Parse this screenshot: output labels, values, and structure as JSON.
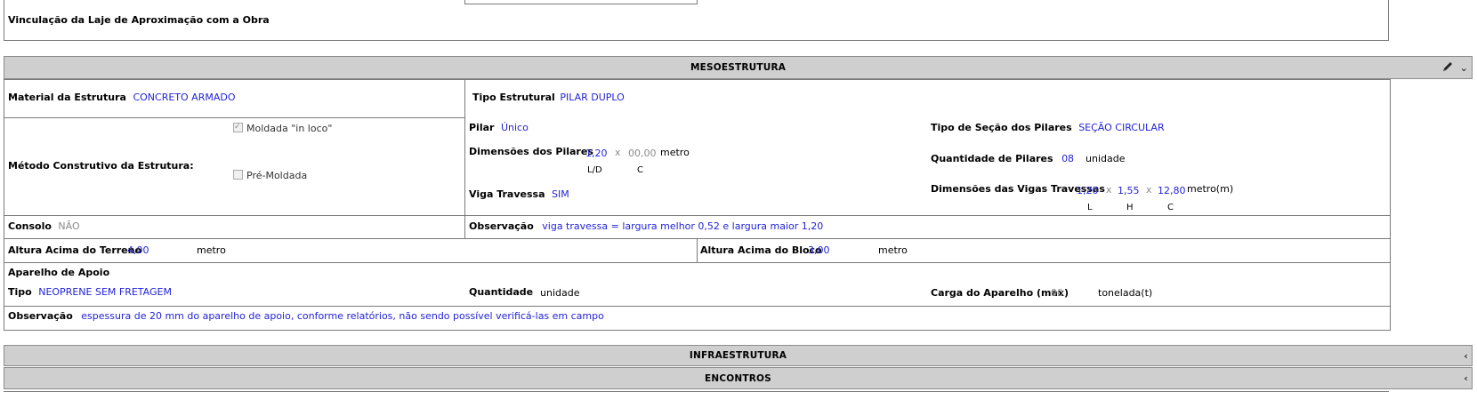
{
  "superestrutura": {
    "vinculacao_label": "Vinculação da Laje de Aproximação com a Obra"
  },
  "meso": {
    "title": "MESOESTRUTURA",
    "material_label": "Material da Estrutura",
    "material_value": "CONCRETO ARMADO",
    "tipo_estrutural_label": "Tipo Estrutural",
    "tipo_estrutural_value": "PILAR DUPLO",
    "metodo_label": "Método Construtivo da Estrutura:",
    "opt_moldada": "Moldada \"in loco\"",
    "opt_pre": "Pré-Moldada",
    "pilar_label": "Pilar",
    "pilar_value": "Único",
    "tipo_secao_label": "Tipo de Seção dos Pilares",
    "tipo_secao_value": "SEÇÃO CIRCULAR",
    "dim_pilares_label": "Dimensões dos Pilares",
    "dim_pilar_ld": "1,20",
    "times": "x",
    "dim_pilar_c": "00,00",
    "unit_metro": "metro",
    "sub_ld": "L/D",
    "sub_c": "C",
    "qtd_pilares_label": "Quantidade de Pilares",
    "qtd_pilares_value": "08",
    "unit_unidade": "unidade",
    "viga_label": "Viga Travessa",
    "viga_value": "SIM",
    "dim_vigas_label": "Dimensões das Vigas Travessas",
    "viga_l": "1,20",
    "viga_h": "1,55",
    "viga_c": "12,80",
    "unit_metro_m": "metro(m)",
    "sub_l": "L",
    "sub_h": "H",
    "consolo_label": "Consolo",
    "consolo_value": "NÃO",
    "obs_label": "Observação",
    "obs_value": "viga travessa = largura melhor 0,52 e largura maior 1,20",
    "altura_terreno_label": "Altura Acima do Terreno",
    "altura_terreno_value": "4,00",
    "altura_bloco_label": "Altura Acima do Bloco",
    "altura_bloco_value": "3,00",
    "aparelho_label": "Aparelho de Apoio",
    "tipo_label": "Tipo",
    "tipo_value": "NEOPRENE SEM FRETAGEM",
    "quantidade_label": "Quantidade",
    "carga_label": "Carga do Aparelho (max)",
    "carga_value": "00",
    "unit_tonelada": "tonelada(t)",
    "obs2_value": "espessura de 20 mm do aparelho de apoio, conforme relatórios, não sendo possível verificá-las em campo"
  },
  "infra": {
    "title": "INFRAESTRUTURA"
  },
  "encontros": {
    "title": "ENCONTROS"
  },
  "icons": {
    "edit": "pencil-icon",
    "expand": "chevron-down-icon",
    "collapsed": "chevron-left-icon"
  }
}
